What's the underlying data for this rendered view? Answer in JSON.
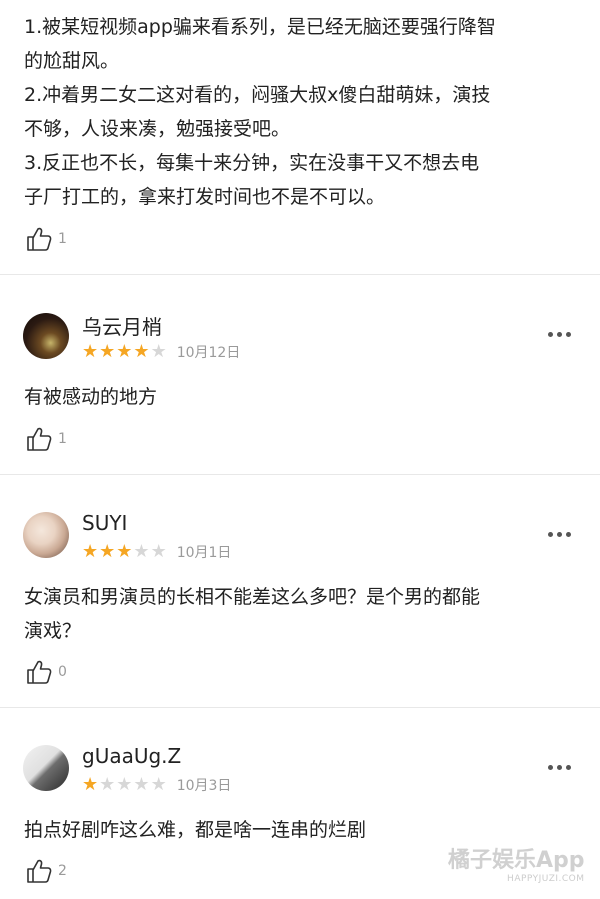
{
  "top_review": {
    "lines": [
      "1.被某短视频app骗来看系列，是已经无脑还要强行降智",
      "的尬甜风。",
      "2.冲着男二女二这对看的，闷骚大叔x傻白甜萌妹，演技",
      "不够，人设来凑，勉强接受吧。",
      "3.反正也不长，每集十来分钟，实在没事干又不想去电",
      "子厂打工的，拿来打发时间也不是不可以。"
    ],
    "likes": "1"
  },
  "reviews": [
    {
      "username": "乌云月梢",
      "rating": 4,
      "date": "10月12日",
      "lines": [
        "有被感动的地方"
      ],
      "likes": "1"
    },
    {
      "username": "SUYI",
      "rating": 3,
      "date": "10月1日",
      "lines": [
        "女演员和男演员的长相不能差这么多吧？是个男的都能",
        "演戏？"
      ],
      "likes": "0"
    },
    {
      "username": "gUaaUg.Z",
      "rating": 1,
      "date": "10月3日",
      "lines": [
        "拍点好剧咋这么难，都是啥一连串的烂剧"
      ],
      "likes": "2"
    }
  ],
  "icons": {
    "like": "thumbs-up-icon",
    "more": "more-dots-icon",
    "star_filled": "star-filled-icon",
    "star_empty": "star-empty-icon"
  },
  "colors": {
    "star": "#f5a623",
    "star_empty": "#d7d7d7",
    "meta_text": "#9a9a9a",
    "divider": "#e8e8e8"
  },
  "watermark": {
    "text": "橘子娱乐App",
    "sub": "HAPPYJUZI.COM"
  }
}
